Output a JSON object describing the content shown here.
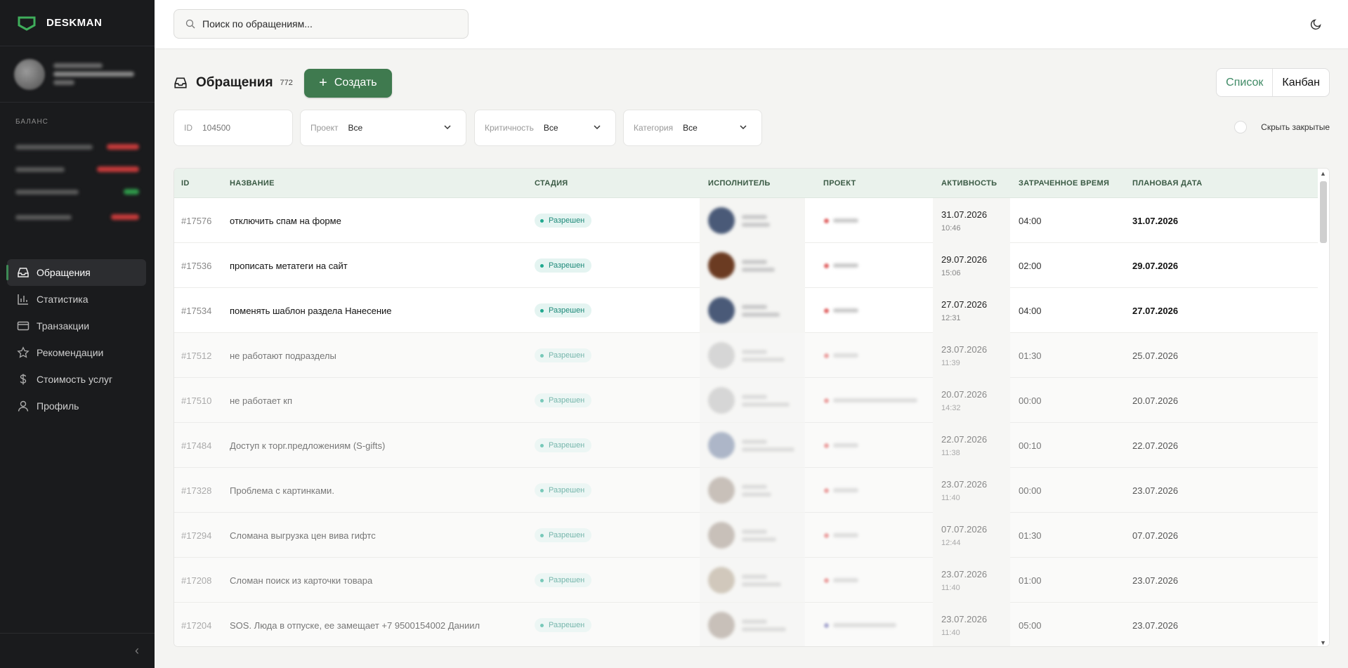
{
  "app": {
    "name": "DESKMAN"
  },
  "sidebar": {
    "balance_title": "БАЛАНС",
    "nav": [
      {
        "label": "Обращения",
        "icon": "inbox-icon",
        "active": true
      },
      {
        "label": "Статистика",
        "icon": "bar-chart-icon"
      },
      {
        "label": "Транзакции",
        "icon": "card-icon"
      },
      {
        "label": "Рекомендации",
        "icon": "star-icon"
      },
      {
        "label": "Стоимость услуг",
        "icon": "dollar-icon"
      },
      {
        "label": "Профиль",
        "icon": "user-icon"
      }
    ]
  },
  "search": {
    "placeholder": "Поиск по обращениям..."
  },
  "page": {
    "title": "Обращения",
    "count": "772",
    "create_label": "Создать"
  },
  "view_toggle": {
    "list": "Список",
    "kanban": "Канбан"
  },
  "filters": {
    "id_label": "ID",
    "id_placeholder": "104500",
    "project_label": "Проект",
    "project_value": "Все",
    "criticality_label": "Критичность",
    "criticality_value": "Все",
    "category_label": "Категория",
    "category_value": "Все",
    "hide_closed": "Скрыть закрытые"
  },
  "table": {
    "headers": [
      "ID",
      "НАЗВАНИЕ",
      "СТАДИЯ",
      "ИСПОЛНИТЕЛЬ",
      "ПРОЕКТ",
      "АКТИВНОСТЬ",
      "ЗАТРАЧЕННОЕ ВРЕМЯ",
      "ПЛАНОВАЯ ДАТА"
    ],
    "rows": [
      {
        "id": "#17576",
        "name": "отключить спам на форме",
        "stage": "Разрешен",
        "act_date": "31.07.2026",
        "act_time": "10:46",
        "spent": "04:00",
        "plan": "31.07.2026"
      },
      {
        "id": "#17536",
        "name": "прописать метатеги на сайт",
        "stage": "Разрешен",
        "act_date": "29.07.2026",
        "act_time": "15:06",
        "spent": "02:00",
        "plan": "29.07.2026"
      },
      {
        "id": "#17534",
        "name": "поменять шаблон раздела Нанесение",
        "stage": "Разрешен",
        "act_date": "27.07.2026",
        "act_time": "12:31",
        "spent": "04:00",
        "plan": "27.07.2026"
      },
      {
        "id": "#17512",
        "name": "не работают подразделы",
        "stage": "Разрешен",
        "act_date": "23.07.2026",
        "act_time": "11:39",
        "spent": "01:30",
        "plan": "25.07.2026"
      },
      {
        "id": "#17510",
        "name": "не работает кп",
        "stage": "Разрешен",
        "act_date": "20.07.2026",
        "act_time": "14:32",
        "spent": "00:00",
        "plan": "20.07.2026"
      },
      {
        "id": "#17484",
        "name": "Доступ к торг.предложениям (S-gifts)",
        "stage": "Разрешен",
        "act_date": "22.07.2026",
        "act_time": "11:38",
        "spent": "00:10",
        "plan": "22.07.2026"
      },
      {
        "id": "#17328",
        "name": "Проблема с картинками.",
        "stage": "Разрешен",
        "act_date": "23.07.2026",
        "act_time": "11:40",
        "spent": "00:00",
        "plan": "23.07.2026"
      },
      {
        "id": "#17294",
        "name": "Сломана выгрузка цен вива гифтс",
        "stage": "Разрешен",
        "act_date": "07.07.2026",
        "act_time": "12:44",
        "spent": "01:30",
        "plan": "07.07.2026"
      },
      {
        "id": "#17208",
        "name": "Сломан поиск из карточки товара",
        "stage": "Разрешен",
        "act_date": "23.07.2026",
        "act_time": "11:40",
        "spent": "01:00",
        "plan": "23.07.2026"
      },
      {
        "id": "#17204",
        "name": "SOS. Люда в отпуске, ее замещает +7 9500154002 Даниил",
        "stage": "Разрешен",
        "act_date": "23.07.2026",
        "act_time": "11:40",
        "spent": "05:00",
        "plan": "23.07.2026"
      }
    ]
  },
  "colors": {
    "accent": "#3f7a4f",
    "sidebar_bg": "#1a1b1d",
    "badge_text": "#1f8a7a"
  }
}
